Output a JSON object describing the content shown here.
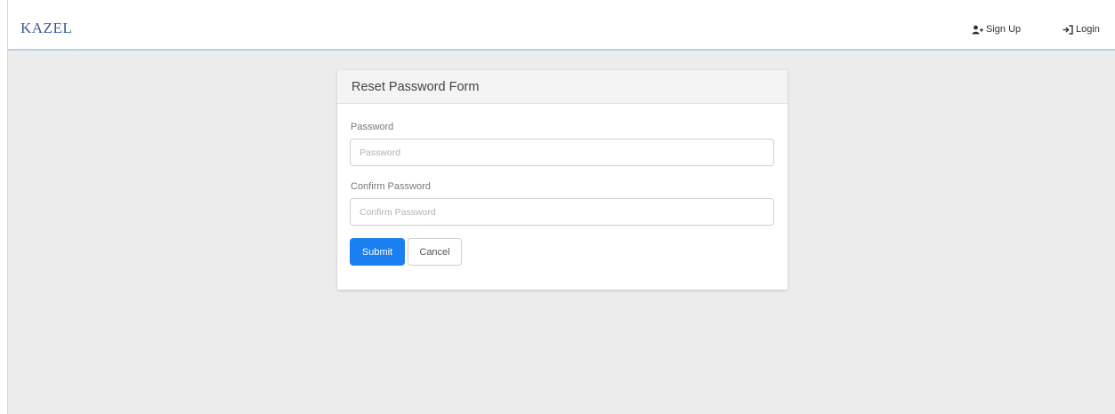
{
  "navbar": {
    "brand": "KAZEL",
    "signup_label": "Sign Up",
    "signup_icon": "add-user-icon",
    "login_label": "Login",
    "login_icon": "sign-in-icon"
  },
  "form": {
    "title": "Reset Password Form",
    "password": {
      "label": "Password",
      "placeholder": "Password",
      "value": ""
    },
    "confirm_password": {
      "label": "Confirm Password",
      "placeholder": "Confirm Password",
      "value": ""
    },
    "submit_label": "Submit",
    "cancel_label": "Cancel"
  },
  "colors": {
    "brand": "#3a5a9a",
    "primary_button": "#1a7ff0",
    "page_background": "#ececec",
    "navbar_border": "#b9cfe8"
  }
}
